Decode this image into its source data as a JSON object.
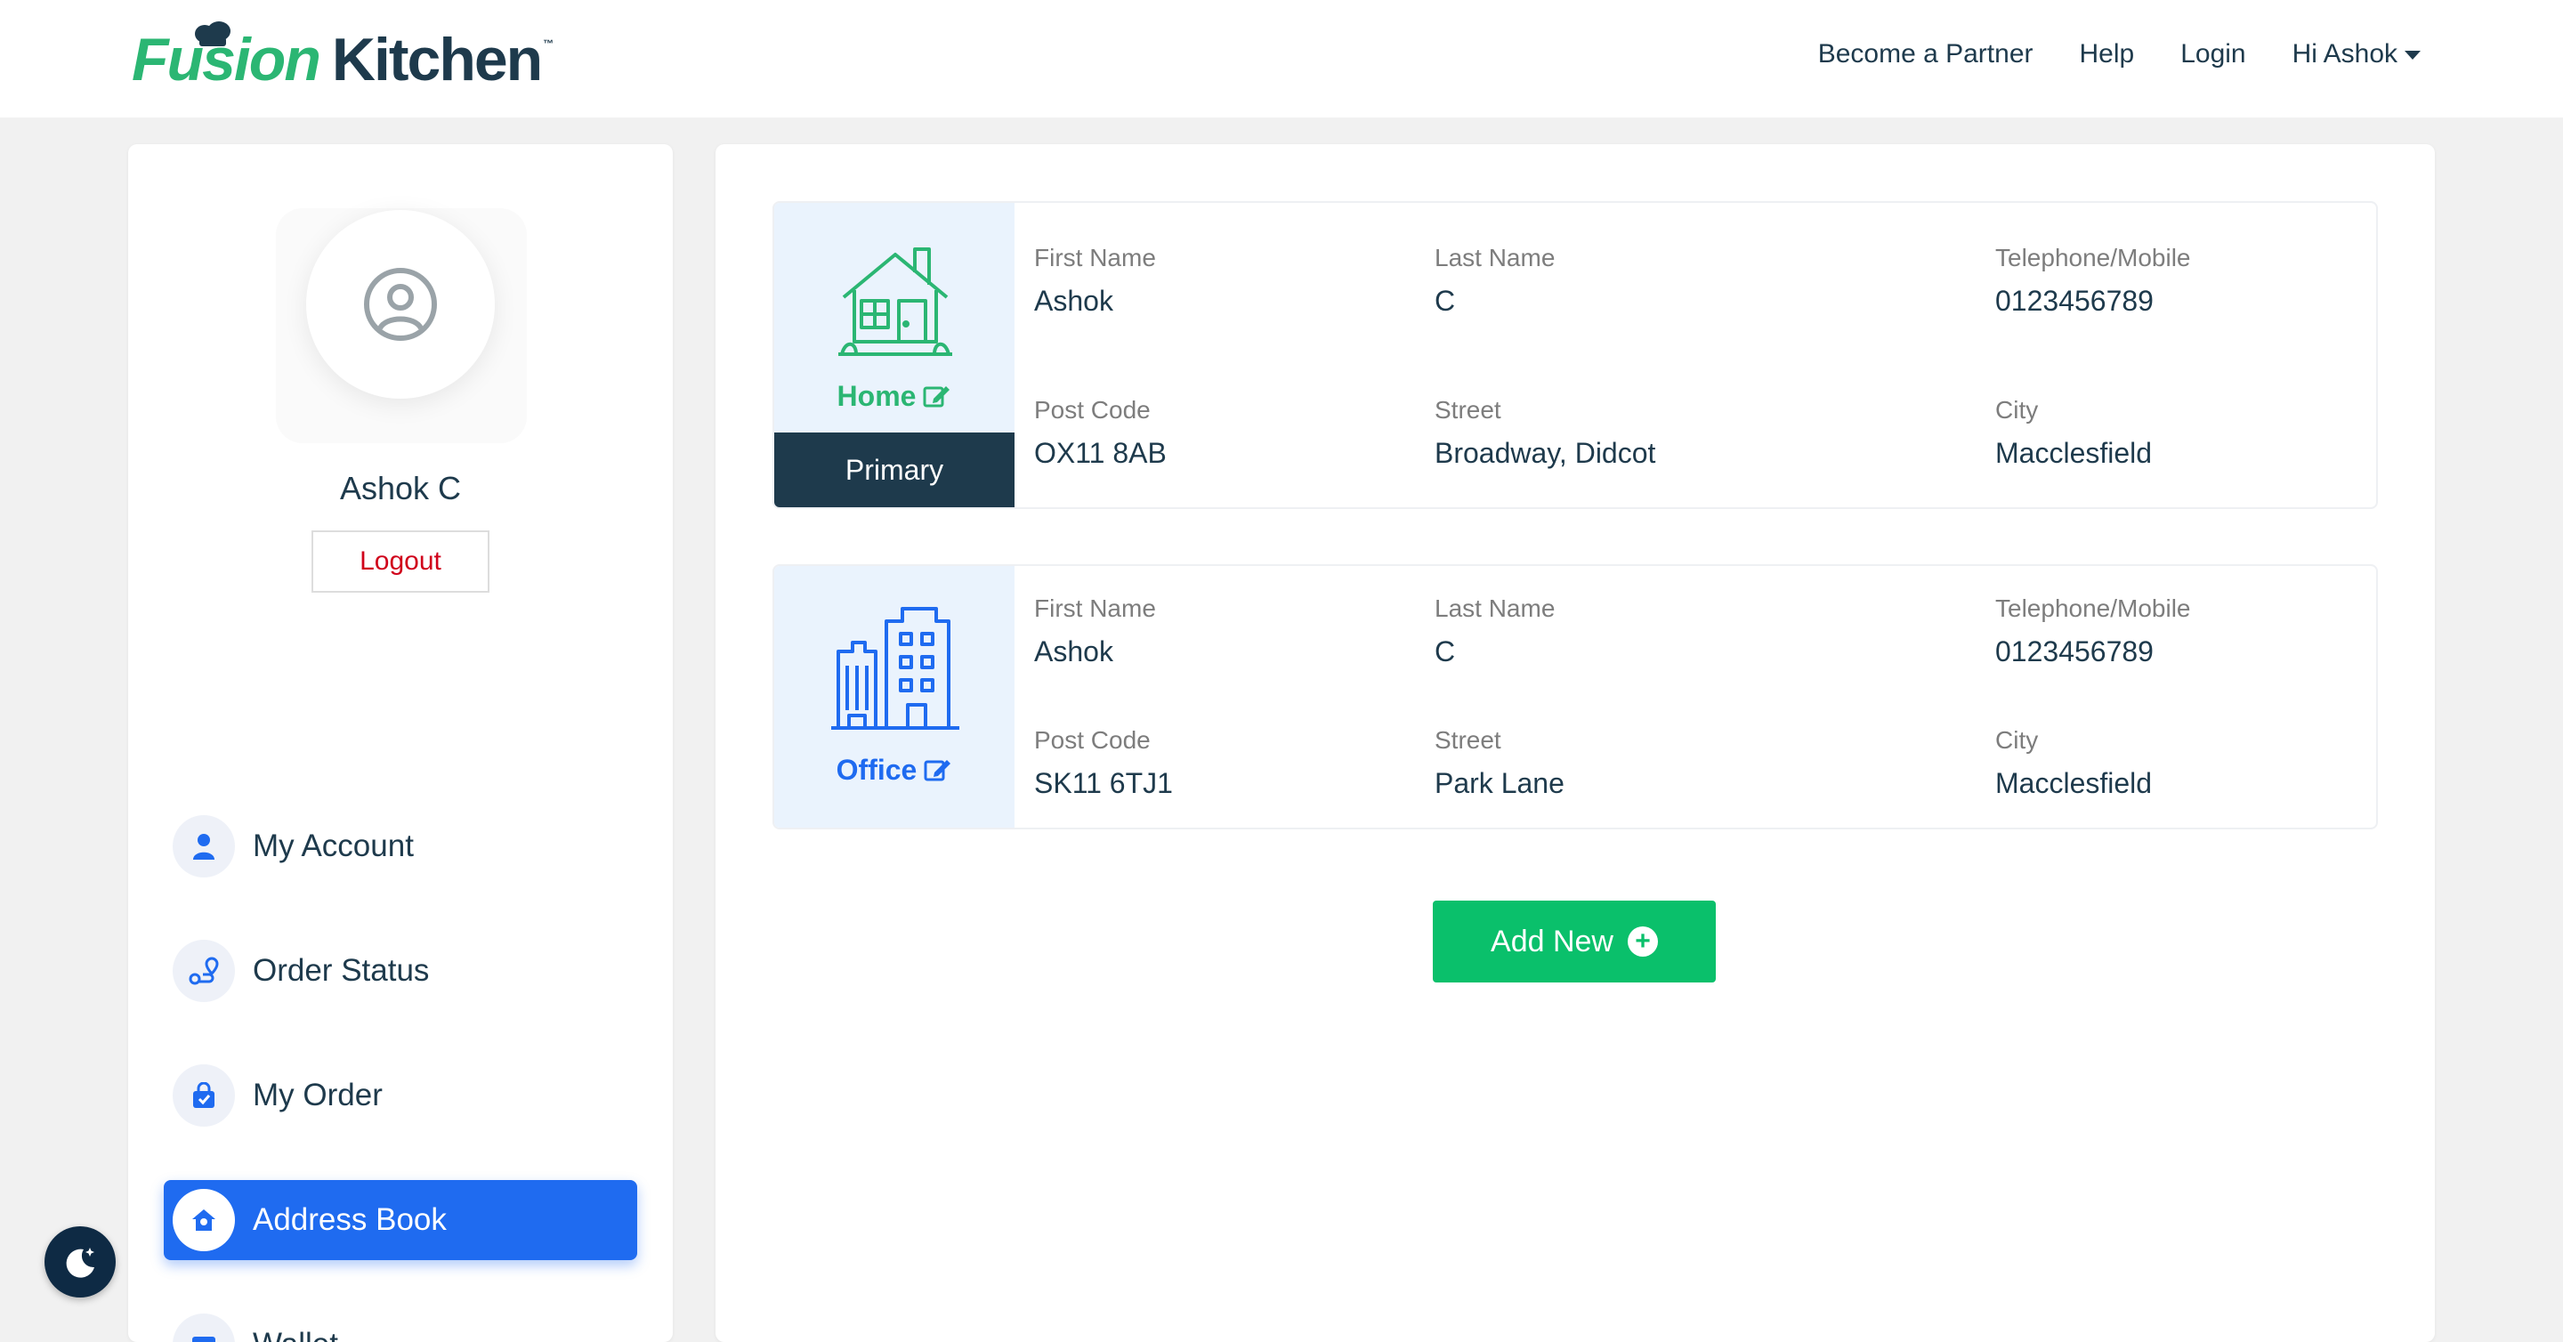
{
  "header": {
    "logo_part1": "Fusion",
    "logo_part2": "Kitchen",
    "logo_tm": "™",
    "nav": {
      "partner": "Become a Partner",
      "help": "Help",
      "login": "Login",
      "greeting": "Hi Ashok"
    }
  },
  "sidebar": {
    "user_name": "Ashok C",
    "logout_label": "Logout",
    "items": [
      {
        "label": "My Account",
        "icon": "user-icon"
      },
      {
        "label": "Order Status",
        "icon": "route-pin-icon"
      },
      {
        "label": "My Order",
        "icon": "shopping-bag-icon"
      },
      {
        "label": "Address Book",
        "icon": "home-location-icon",
        "active": true
      },
      {
        "label": "Wallet",
        "icon": "wallet-icon"
      }
    ]
  },
  "addresses": [
    {
      "type": "Home",
      "tag": "Primary",
      "icon": "house-icon",
      "accent": "#2bb673",
      "labels": {
        "first_name": "First Name",
        "last_name": "Last Name",
        "phone": "Telephone/Mobile",
        "post_code": "Post Code",
        "street": "Street",
        "city": "City"
      },
      "first_name": "Ashok",
      "last_name": "C",
      "phone": "0123456789",
      "post_code": "OX11 8AB",
      "street": "Broadway, Didcot",
      "city": "Macclesfield"
    },
    {
      "type": "Office",
      "icon": "office-building-icon",
      "accent": "#1f6bf0",
      "labels": {
        "first_name": "First Name",
        "last_name": "Last Name",
        "phone": "Telephone/Mobile",
        "post_code": "Post Code",
        "street": "Street",
        "city": "City"
      },
      "first_name": "Ashok",
      "last_name": "C",
      "phone": "0123456789",
      "post_code": "SK11 6TJ1",
      "street": "Park Lane",
      "city": "Macclesfield"
    }
  ],
  "add_new_label": "Add New",
  "colors": {
    "primary_blue": "#1f6bf0",
    "green": "#0ac06b",
    "navy": "#1e3a4c",
    "logout_red": "#d0021b"
  }
}
